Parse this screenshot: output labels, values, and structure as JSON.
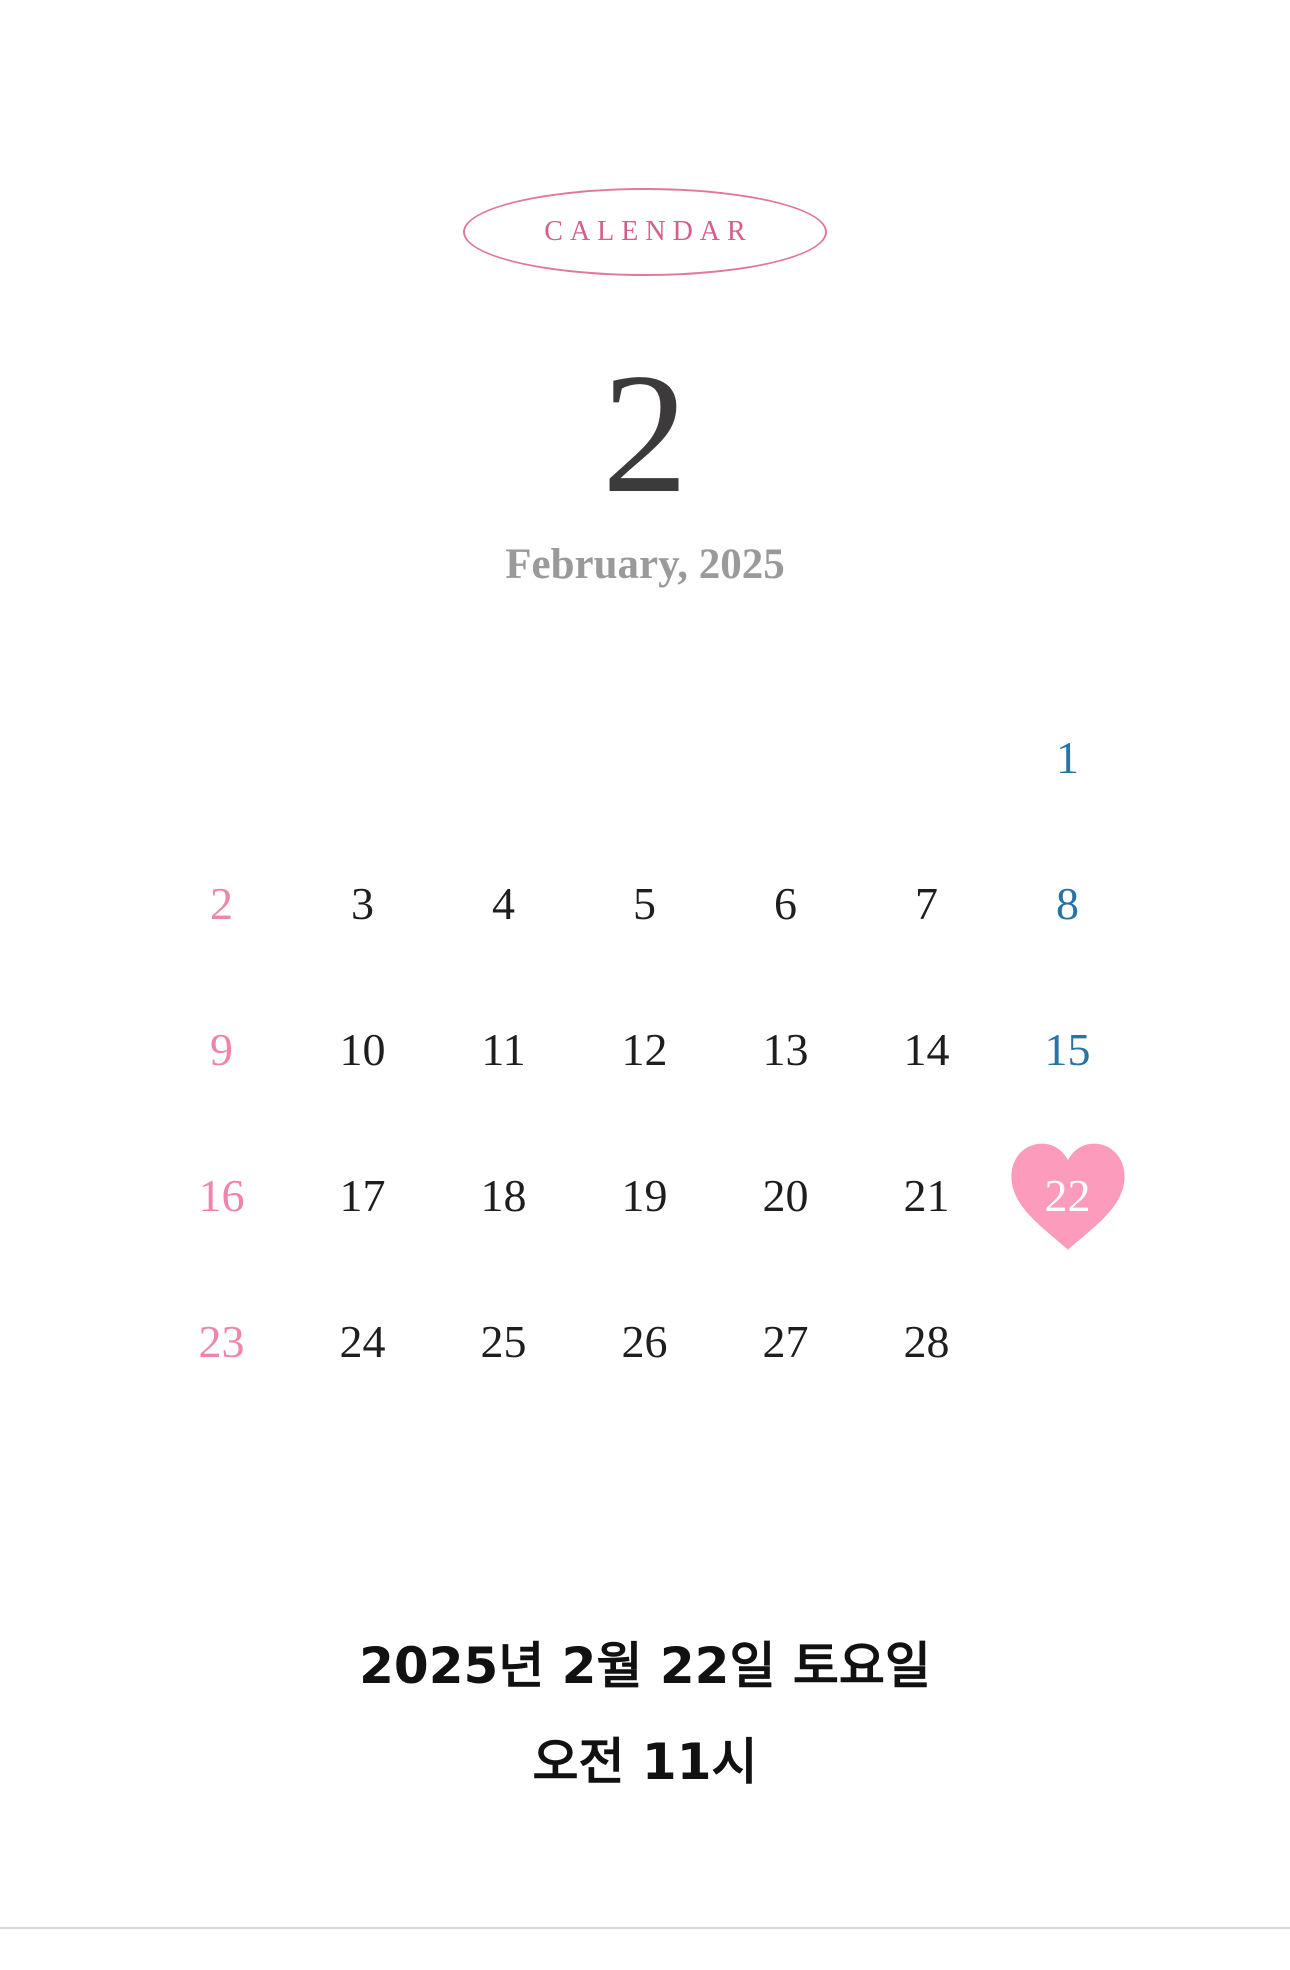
{
  "badge": {
    "label": "CALENDAR"
  },
  "month": {
    "number": "2",
    "label": "February, 2025"
  },
  "calendar": {
    "leading_blank_cells": 6,
    "selected_day": "22",
    "days": [
      {
        "num": "1",
        "type": "sat"
      },
      {
        "num": "2",
        "type": "sun"
      },
      {
        "num": "3",
        "type": "weekday"
      },
      {
        "num": "4",
        "type": "weekday"
      },
      {
        "num": "5",
        "type": "weekday"
      },
      {
        "num": "6",
        "type": "weekday"
      },
      {
        "num": "7",
        "type": "weekday"
      },
      {
        "num": "8",
        "type": "sat"
      },
      {
        "num": "9",
        "type": "sun"
      },
      {
        "num": "10",
        "type": "weekday"
      },
      {
        "num": "11",
        "type": "weekday"
      },
      {
        "num": "12",
        "type": "weekday"
      },
      {
        "num": "13",
        "type": "weekday"
      },
      {
        "num": "14",
        "type": "weekday"
      },
      {
        "num": "15",
        "type": "sat"
      },
      {
        "num": "16",
        "type": "sun"
      },
      {
        "num": "17",
        "type": "weekday"
      },
      {
        "num": "18",
        "type": "weekday"
      },
      {
        "num": "19",
        "type": "weekday"
      },
      {
        "num": "20",
        "type": "weekday"
      },
      {
        "num": "21",
        "type": "weekday"
      },
      {
        "num": "22",
        "type": "sat"
      },
      {
        "num": "23",
        "type": "sun"
      },
      {
        "num": "24",
        "type": "weekday"
      },
      {
        "num": "25",
        "type": "weekday"
      },
      {
        "num": "26",
        "type": "weekday"
      },
      {
        "num": "27",
        "type": "weekday"
      },
      {
        "num": "28",
        "type": "weekday"
      }
    ]
  },
  "event": {
    "date": "2025년 2월 22일 토요일",
    "time": "오전 11시"
  },
  "colors": {
    "accent_pink": "#e0779d",
    "sunday": "#ef84ad",
    "saturday": "#2774a8",
    "heart": "#fd9bbd",
    "month_number": "#3d3a3b",
    "month_label": "#9a9a9a"
  },
  "icons": {
    "selected_marker": "heart-icon"
  }
}
